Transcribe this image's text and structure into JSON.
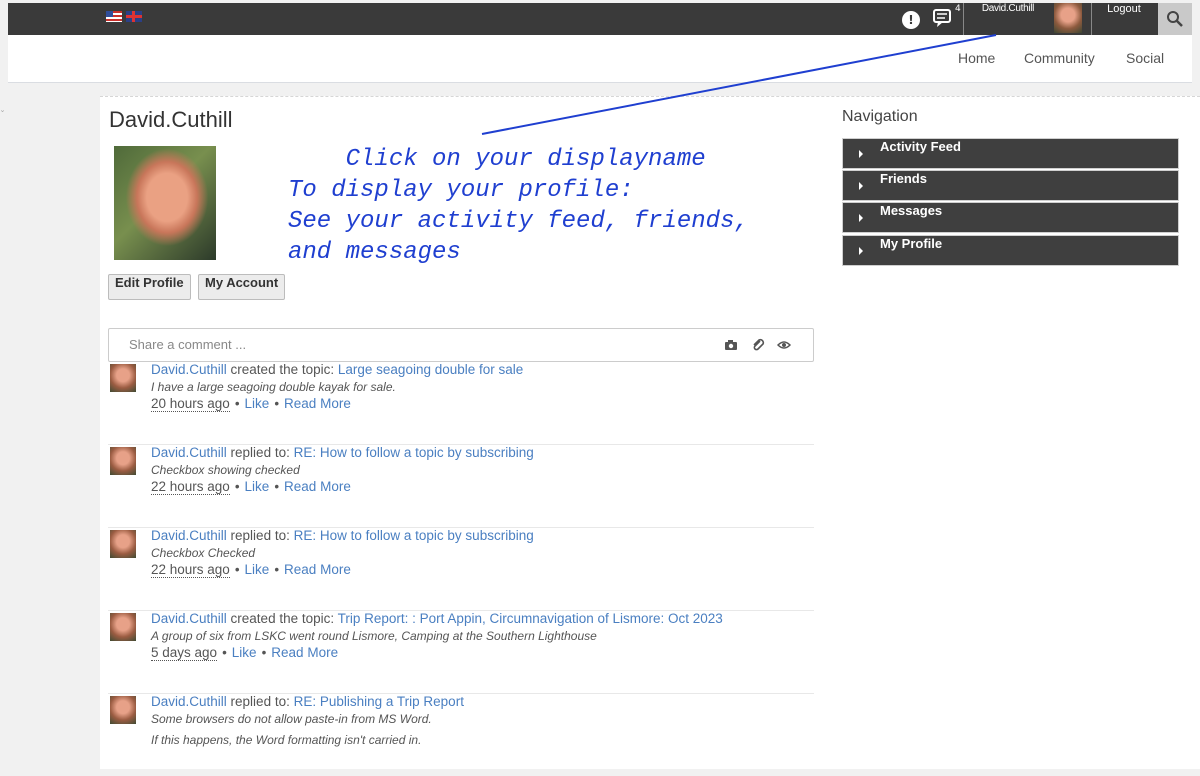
{
  "topbar": {
    "flags": [
      "us-flag-icon",
      "uk-flag-icon"
    ],
    "notification_icon": "alert-bubble-icon",
    "messages_icon": "chat-icon",
    "messages_count": "4",
    "username": "David.Cuthill",
    "logout_label": "Logout",
    "search_icon": "search-icon"
  },
  "nav": {
    "links": [
      "Home",
      "Community",
      "Social"
    ]
  },
  "profile": {
    "name": "David.Cuthill",
    "edit_label": "Edit Profile",
    "account_label": "My Account"
  },
  "annotation": {
    "text": "    Click on your displayname\nTo display your profile:\nSee your activity feed, friends,\nand messages",
    "color": "#1f3fd0"
  },
  "share": {
    "placeholder": "Share a comment ..."
  },
  "feed": [
    {
      "user": "David.Cuthill",
      "action": "created the topic:",
      "topic": "Large seagoing double for sale",
      "excerpt": "I have a large seagoing double kayak for sale.",
      "time": "20 hours ago",
      "like": "Like",
      "read_more": "Read More"
    },
    {
      "user": "David.Cuthill",
      "action": "replied to:",
      "topic": "RE: How to follow a topic by subscribing",
      "excerpt": "Checkbox showing checked",
      "time": "22 hours ago",
      "like": "Like",
      "read_more": "Read More"
    },
    {
      "user": "David.Cuthill",
      "action": "replied to:",
      "topic": "RE: How to follow a topic by subscribing",
      "excerpt": "Checkbox Checked",
      "time": "22 hours ago",
      "like": "Like",
      "read_more": "Read More"
    },
    {
      "user": "David.Cuthill",
      "action": "created the topic:",
      "topic": "Trip Report: : Port Appin, Circumnavigation of Lismore: Oct 2023",
      "excerpt": "A group of six from LSKC went round Lismore, Camping at the Southern Lighthouse",
      "time": "5 days ago",
      "like": "Like",
      "read_more": "Read More"
    },
    {
      "user": "David.Cuthill",
      "action": "replied to:",
      "topic": "RE: Publishing a Trip Report",
      "excerpt": "Some browsers do not allow paste-in from MS Word.",
      "excerpt2": "If this happens, the Word formatting isn't carried in."
    }
  ],
  "sidebar": {
    "title": "Navigation",
    "items": [
      "Activity Feed",
      "Friends",
      "Messages",
      "My Profile"
    ]
  },
  "colors": {
    "topbar": "#3a3a3a",
    "link": "#4a7fc1",
    "nav_item": "#3f3f3f"
  }
}
